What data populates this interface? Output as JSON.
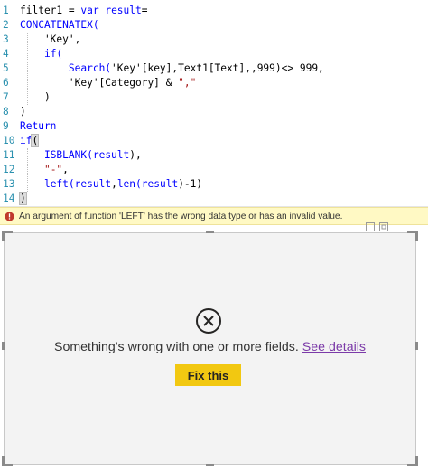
{
  "editor": {
    "lines": [
      {
        "num": "1",
        "tokens": [
          {
            "t": "filter1 = ",
            "c": "pl"
          },
          {
            "t": "var",
            "c": "kw"
          },
          {
            "t": " ",
            "c": "pl"
          },
          {
            "t": "result",
            "c": "kw"
          },
          {
            "t": "=",
            "c": "pl"
          }
        ]
      },
      {
        "num": "2",
        "tokens": [
          {
            "t": "CONCATENATEX(",
            "c": "fn"
          }
        ]
      },
      {
        "num": "3",
        "tokens": [
          {
            "t": "    'Key',",
            "c": "pl"
          }
        ]
      },
      {
        "num": "4",
        "tokens": [
          {
            "t": "    ",
            "c": "pl"
          },
          {
            "t": "if(",
            "c": "fn"
          }
        ]
      },
      {
        "num": "5",
        "tokens": [
          {
            "t": "        ",
            "c": "pl"
          },
          {
            "t": "Search(",
            "c": "fn"
          },
          {
            "t": "'Key'[key],Text1[Text],,999)<> 999,",
            "c": "pl"
          }
        ]
      },
      {
        "num": "6",
        "tokens": [
          {
            "t": "        'Key'[Category] & ",
            "c": "pl"
          },
          {
            "t": "\",\"",
            "c": "str"
          }
        ]
      },
      {
        "num": "7",
        "tokens": [
          {
            "t": "    )",
            "c": "pl"
          }
        ]
      },
      {
        "num": "8",
        "tokens": [
          {
            "t": ")",
            "c": "pl"
          }
        ]
      },
      {
        "num": "9",
        "tokens": [
          {
            "t": "Return",
            "c": "kw"
          }
        ]
      },
      {
        "num": "10",
        "tokens": [
          {
            "t": "if",
            "c": "fn"
          },
          {
            "t": "(",
            "c": "hl"
          }
        ]
      },
      {
        "num": "11",
        "tokens": [
          {
            "t": "    ",
            "c": "pl"
          },
          {
            "t": "ISBLANK(",
            "c": "fn"
          },
          {
            "t": "result",
            "c": "kw"
          },
          {
            "t": "),",
            "c": "pl"
          }
        ]
      },
      {
        "num": "12",
        "tokens": [
          {
            "t": "    ",
            "c": "pl"
          },
          {
            "t": "\"-\"",
            "c": "str"
          },
          {
            "t": ",",
            "c": "pl"
          }
        ]
      },
      {
        "num": "13",
        "tokens": [
          {
            "t": "    ",
            "c": "pl"
          },
          {
            "t": "left(",
            "c": "fn"
          },
          {
            "t": "result",
            "c": "kw"
          },
          {
            "t": ",",
            "c": "pl"
          },
          {
            "t": "len(",
            "c": "fn"
          },
          {
            "t": "result",
            "c": "kw"
          },
          {
            "t": ")-1)",
            "c": "pl"
          }
        ]
      },
      {
        "num": "14",
        "tokens": [
          {
            "t": ")",
            "c": "hl"
          }
        ]
      }
    ]
  },
  "error": {
    "icon": "warning-icon",
    "message": "An argument of function 'LEFT' has the wrong data type or has an invalid value."
  },
  "visual": {
    "icon": "circle-x-icon",
    "message": "Something's wrong with one or more fields.",
    "link_label": "See details",
    "button_label": "Fix this"
  },
  "colors": {
    "keyword": "#0000ff",
    "string": "#a31515",
    "line_number": "#2b91af",
    "error_bar": "#fff9c4",
    "link": "#7b3aa8",
    "button": "#f2c811"
  }
}
